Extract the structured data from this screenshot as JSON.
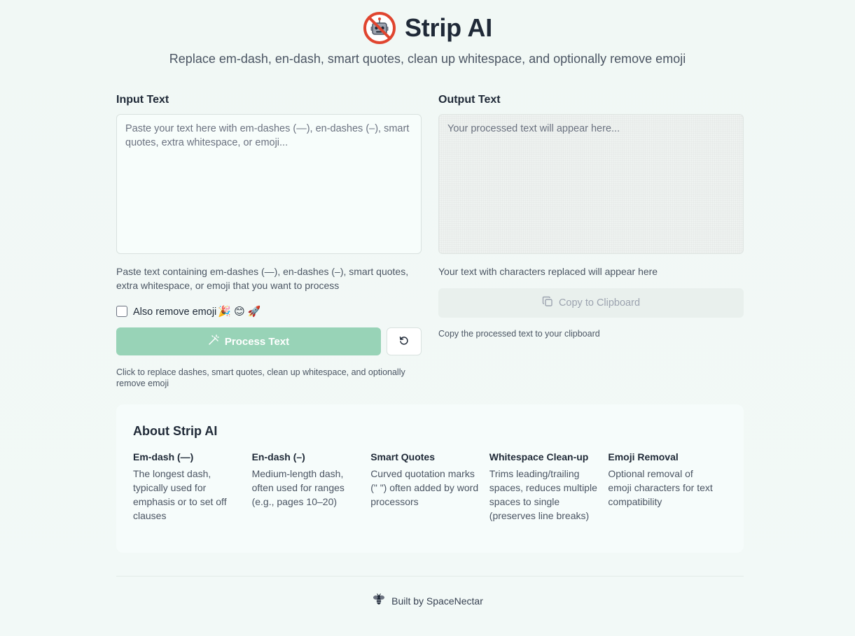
{
  "header": {
    "title": "Strip AI",
    "subtitle": "Replace em-dash, en-dash, smart quotes, clean up whitespace, and optionally remove emoji",
    "logo_icon": "no-robot-icon"
  },
  "input": {
    "label": "Input Text",
    "placeholder": "Paste your text here with em-dashes (—), en-dashes (–), smart quotes, extra whitespace, or emoji...",
    "value": "",
    "help": "Paste text containing em-dashes (—), en-dashes (–), smart quotes, extra whitespace, or emoji that you want to process"
  },
  "emoji_option": {
    "label": "Also remove emoji",
    "emojis": "🎉 😊 🚀",
    "checked": false
  },
  "actions": {
    "process_label": "Process Text",
    "process_icon": "magic-wand-icon",
    "reset_icon": "reset-icon",
    "help": "Click to replace dashes, smart quotes, clean up whitespace, and optionally remove emoji"
  },
  "output": {
    "label": "Output Text",
    "placeholder": "Your processed text will appear here...",
    "value": "",
    "help": "Your text with characters replaced will appear here"
  },
  "copy": {
    "label": "Copy to Clipboard",
    "icon": "copy-icon",
    "help": "Copy the processed text to your clipboard"
  },
  "about": {
    "title": "About Strip AI",
    "features": [
      {
        "title": "Em-dash (—)",
        "desc": "The longest dash, typically used for emphasis or to set off clauses"
      },
      {
        "title": "En-dash (–)",
        "desc": "Medium-length dash, often used for ranges (e.g., pages 10–20)"
      },
      {
        "title": "Smart Quotes",
        "desc": "Curved quotation marks (\" \") often added by word processors"
      },
      {
        "title": "Whitespace Clean-up",
        "desc": "Trims leading/trailing spaces, reduces multiple spaces to single (preserves line breaks)"
      },
      {
        "title": "Emoji Removal",
        "desc": "Optional removal of emoji characters for text compatibility"
      }
    ]
  },
  "footer": {
    "text": "Built by SpaceNectar",
    "icon": "bee-icon"
  },
  "colors": {
    "accent": "#98d3b7",
    "background": "#f1f8f5",
    "text": "#1f2937"
  }
}
